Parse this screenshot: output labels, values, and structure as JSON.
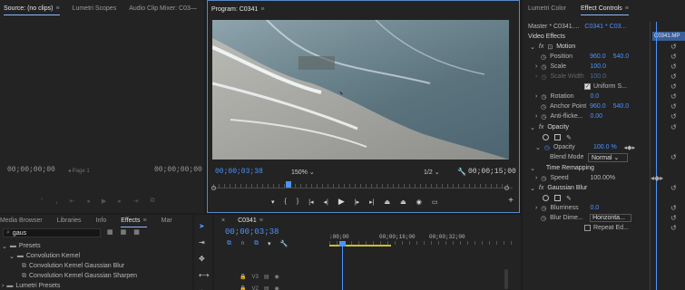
{
  "source_panel": {
    "tabs": [
      "Source: (no clips)",
      "Lumetri Scopes",
      "Audio Clip Mixer: C03—"
    ],
    "timecode_left": "00;00;00;00",
    "timecode_right": "00;00;00;00",
    "page_label": "Page 1"
  },
  "program_panel": {
    "tab": "Program: C0341",
    "timecode_current": "00;00;03;38",
    "zoom": "150%",
    "fraction": "1/2",
    "timecode_duration": "00;00;15;00"
  },
  "effect_panel": {
    "tabs": [
      "Lumetri Color",
      "Effect Controls"
    ],
    "master_label": "Master * C0341....",
    "clip_label": "C0341 * C03...",
    "timeline_clip": "C0341.MP",
    "video_effects_label": "Video Effects",
    "motion": {
      "label": "Motion",
      "position_label": "Position",
      "position_x": "960.0",
      "position_y": "540.0",
      "scale_label": "Scale",
      "scale_value": "100.0",
      "scale_width_label": "Scale Width",
      "scale_width_value": "100.0",
      "uniform_scale_label": "Uniform S...",
      "rotation_label": "Rotation",
      "rotation_value": "0.0",
      "anchor_label": "Anchor Point",
      "anchor_x": "960.0",
      "anchor_y": "540.0",
      "antiflicker_label": "Anti-flicke...",
      "antiflicker_value": "0.00"
    },
    "opacity": {
      "label": "Opacity",
      "opacity_label": "Opacity",
      "opacity_value": "100.0 %",
      "blend_label": "Blend Mode",
      "blend_value": "Normal"
    },
    "time_remap": {
      "label": "Time Remapping",
      "speed_label": "Speed",
      "speed_value": "100.00%"
    },
    "gaussian": {
      "label": "Gaussian Blur",
      "blurriness_label": "Blurriness",
      "blurriness_value": "0.0",
      "dimension_label": "Blur Dime...",
      "dimension_value": "Horizonta...",
      "repeat_label": "Repeat Ed..."
    }
  },
  "effects_panel": {
    "tabs": [
      "Media Browser",
      "Libraries",
      "Info",
      "Effects",
      "Mar"
    ],
    "search_value": "gaus",
    "tree": [
      "Presets",
      "Convolution Kernel",
      "Convolution Kernel Gaussian Blur",
      "Convolution Kernel Gaussian Sharpen",
      "Lumetri Presets"
    ]
  },
  "timeline_panel": {
    "tab": "C0341",
    "timecode": "00;00;03;38",
    "ruler": [
      ":00;00",
      "00;00;16;00",
      "00;00;32;00"
    ],
    "tracks": [
      "V3",
      "V2"
    ]
  },
  "colors": {
    "accent_blue": "#4b93ff",
    "panel_bg": "#232323",
    "playhead": "#4b93ff",
    "work_area": "#c8c02a"
  }
}
